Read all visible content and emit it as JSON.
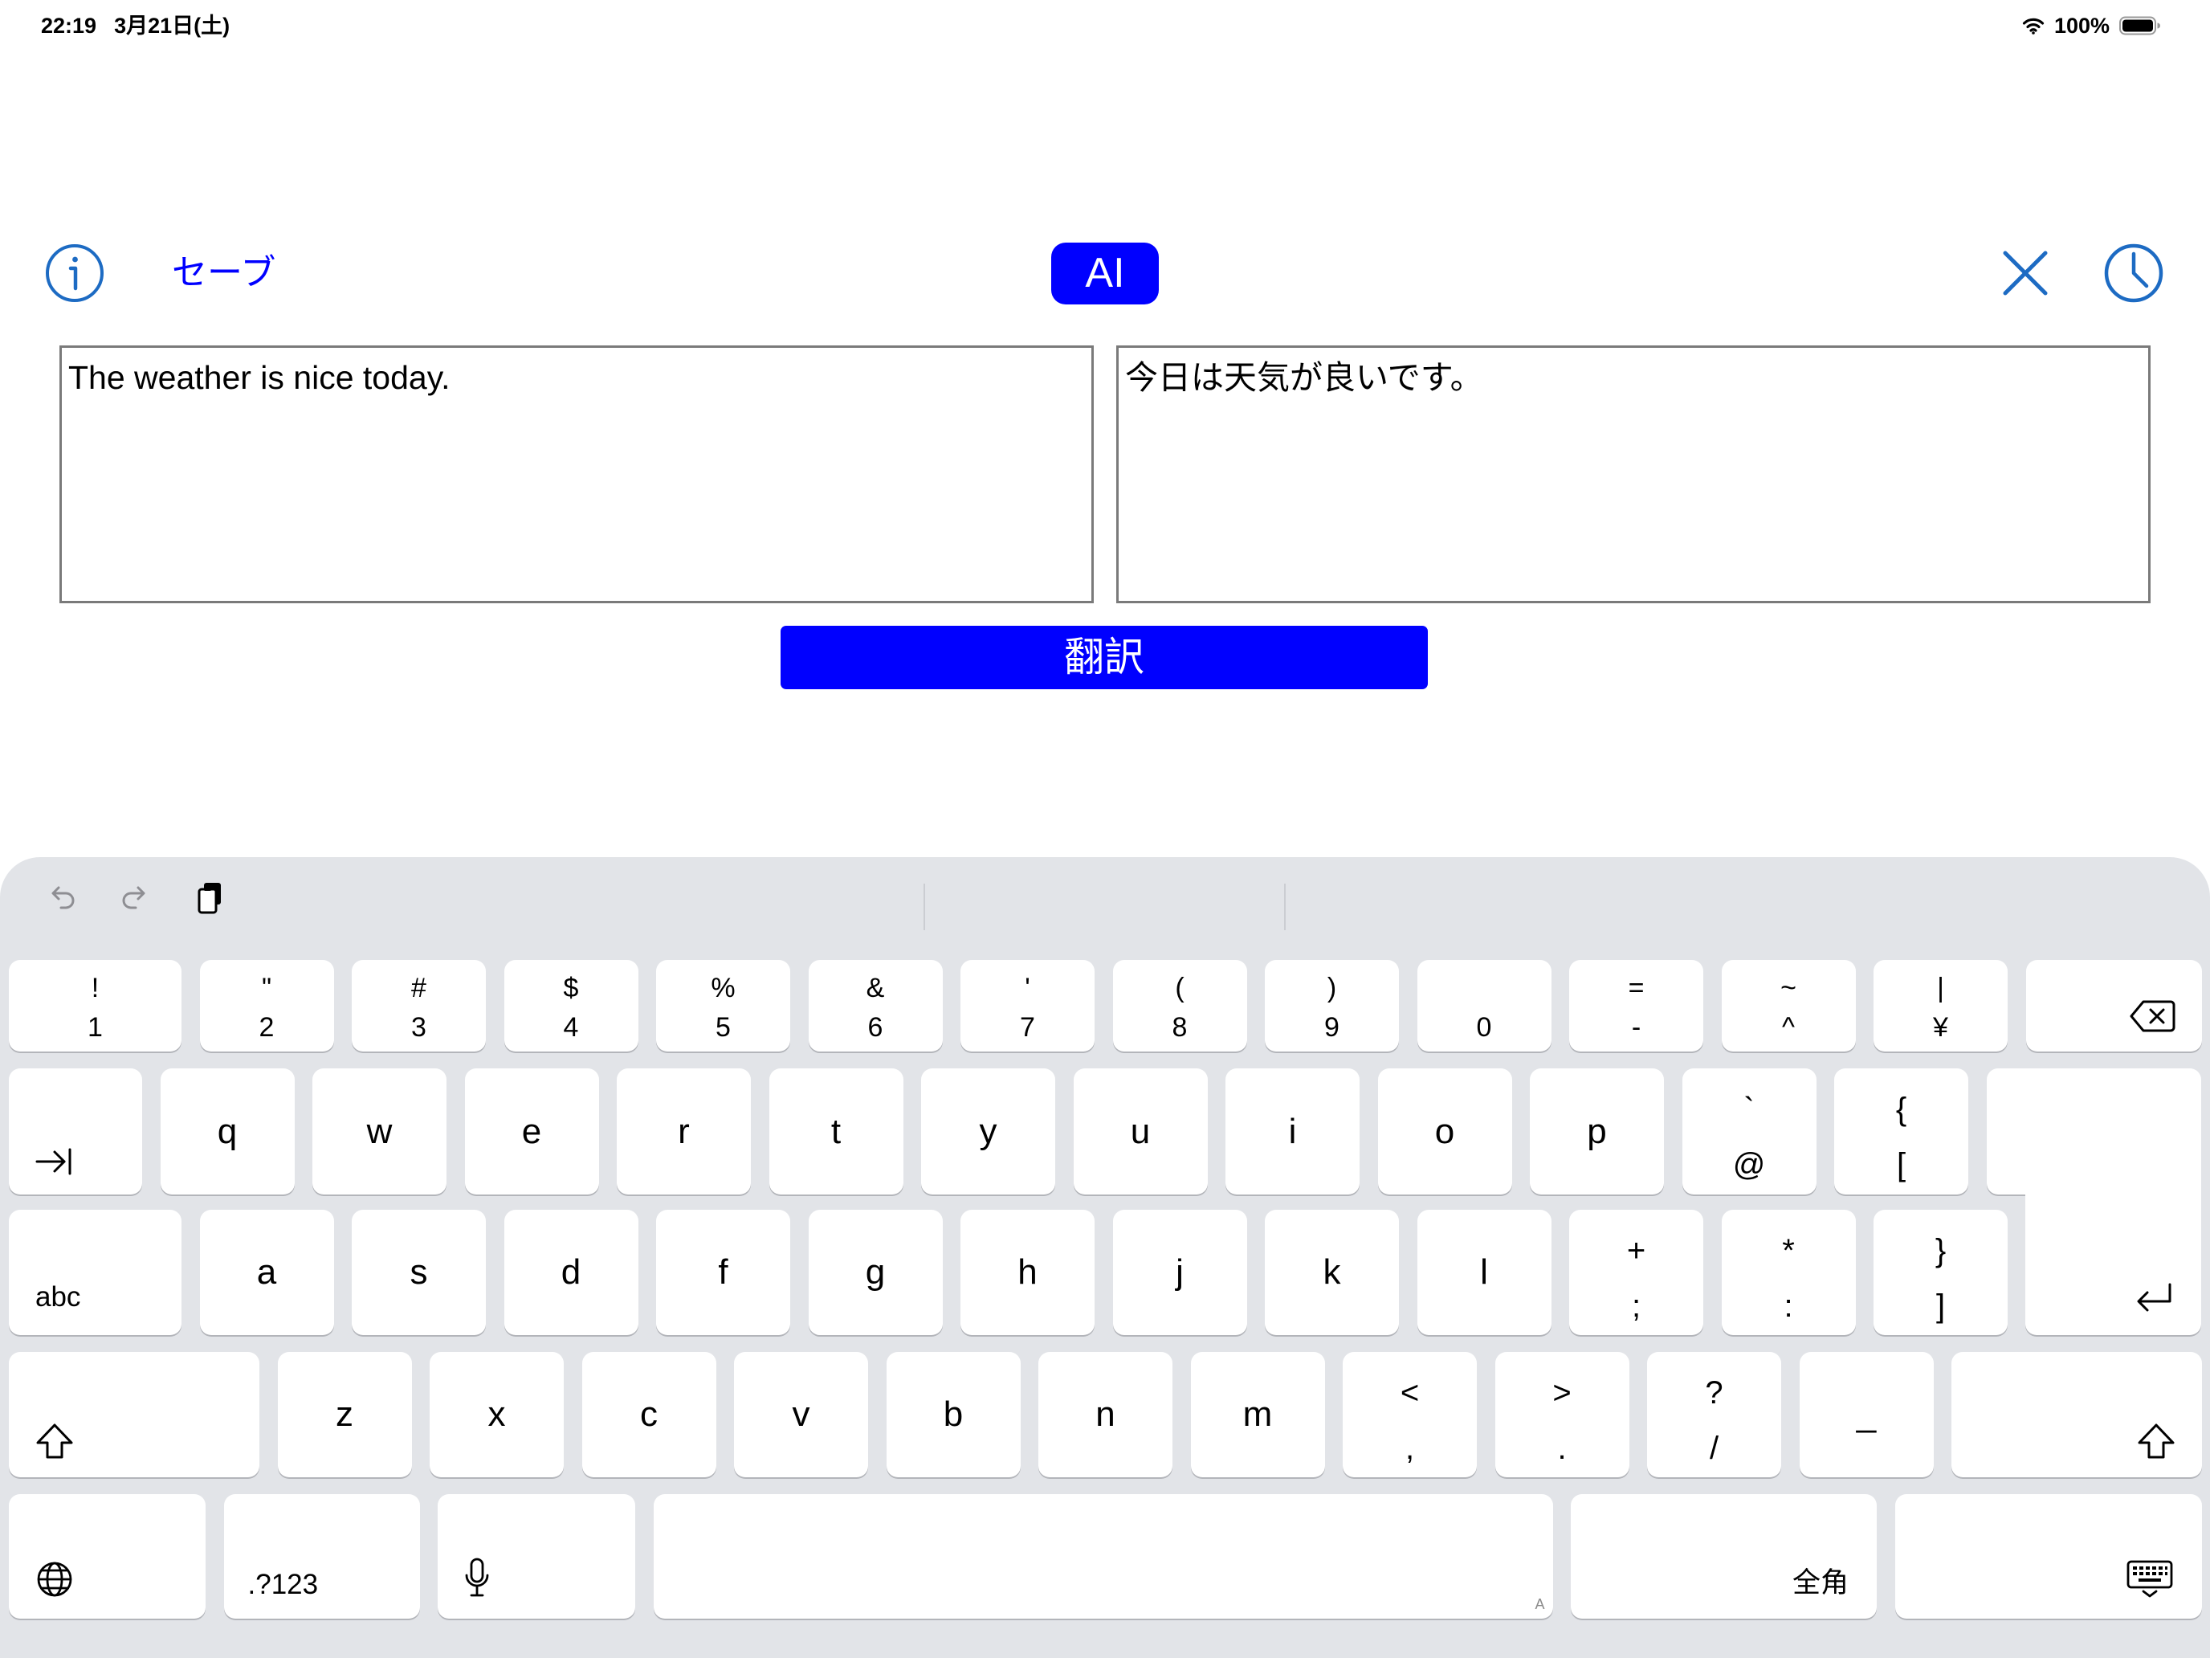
{
  "status_bar": {
    "time": "22:19",
    "date": "3月21日(土)",
    "battery_percent": "100%",
    "wifi_icon": "wifi-icon",
    "battery_icon": "battery-icon"
  },
  "toolbar": {
    "info_icon": "info-icon",
    "save_label": "セーブ",
    "ai_label": "AI",
    "close_icon": "close-icon",
    "history_icon": "clock-icon"
  },
  "source_text": "The weather is nice today.",
  "translated_text": "今日は天気が良いです。",
  "translate_button_label": "翻訳",
  "colors": {
    "accent": "#0000FF",
    "icon_blue": "#1D6BC3",
    "keyboard_background": "#E2E4E8",
    "key_background": "#FFFFFF"
  },
  "keyboard": {
    "toolbar": {
      "undo_icon": "undo-icon",
      "redo_icon": "redo-icon",
      "paste_icon": "paste-icon"
    },
    "number_row": [
      {
        "top": "!",
        "bottom": "1"
      },
      {
        "top": "\"",
        "bottom": "2"
      },
      {
        "top": "#",
        "bottom": "3"
      },
      {
        "top": "$",
        "bottom": "4"
      },
      {
        "top": "%",
        "bottom": "5"
      },
      {
        "top": "&",
        "bottom": "6"
      },
      {
        "top": "'",
        "bottom": "7"
      },
      {
        "top": "(",
        "bottom": "8"
      },
      {
        "top": ")",
        "bottom": "9"
      },
      {
        "bottom": "0"
      },
      {
        "top": "=",
        "bottom": "-"
      },
      {
        "top": "~",
        "bottom": "^"
      },
      {
        "top": "|",
        "bottom": "¥"
      }
    ],
    "top_row": [
      "q",
      "w",
      "e",
      "r",
      "t",
      "y",
      "u",
      "i",
      "o",
      "p",
      {
        "top": "`",
        "bottom": "@"
      },
      {
        "top": "{",
        "bottom": "["
      }
    ],
    "home_row": [
      "a",
      "s",
      "d",
      "f",
      "g",
      "h",
      "j",
      "k",
      "l",
      {
        "top": "+",
        "bottom": ";"
      },
      {
        "top": "*",
        "bottom": ":"
      },
      {
        "top": "}",
        "bottom": "]"
      }
    ],
    "bottom_row": [
      "z",
      "x",
      "c",
      "v",
      "b",
      "n",
      "m",
      {
        "top": "<",
        "bottom": ","
      },
      {
        "top": ">",
        "bottom": "."
      },
      {
        "top": "?",
        "bottom": "/"
      },
      "_"
    ],
    "delete_icon": "delete-icon",
    "tab_icon": "tab-icon",
    "return_icon": "return-icon",
    "shift_icon": "shift-icon",
    "caps_label": "abc",
    "globe_icon": "globe-icon",
    "numbers_label": ".?123",
    "mic_icon": "mic-icon",
    "space_hint": "A",
    "zenkaku_label": "全角",
    "dismiss_icon": "keyboard-dismiss-icon"
  }
}
